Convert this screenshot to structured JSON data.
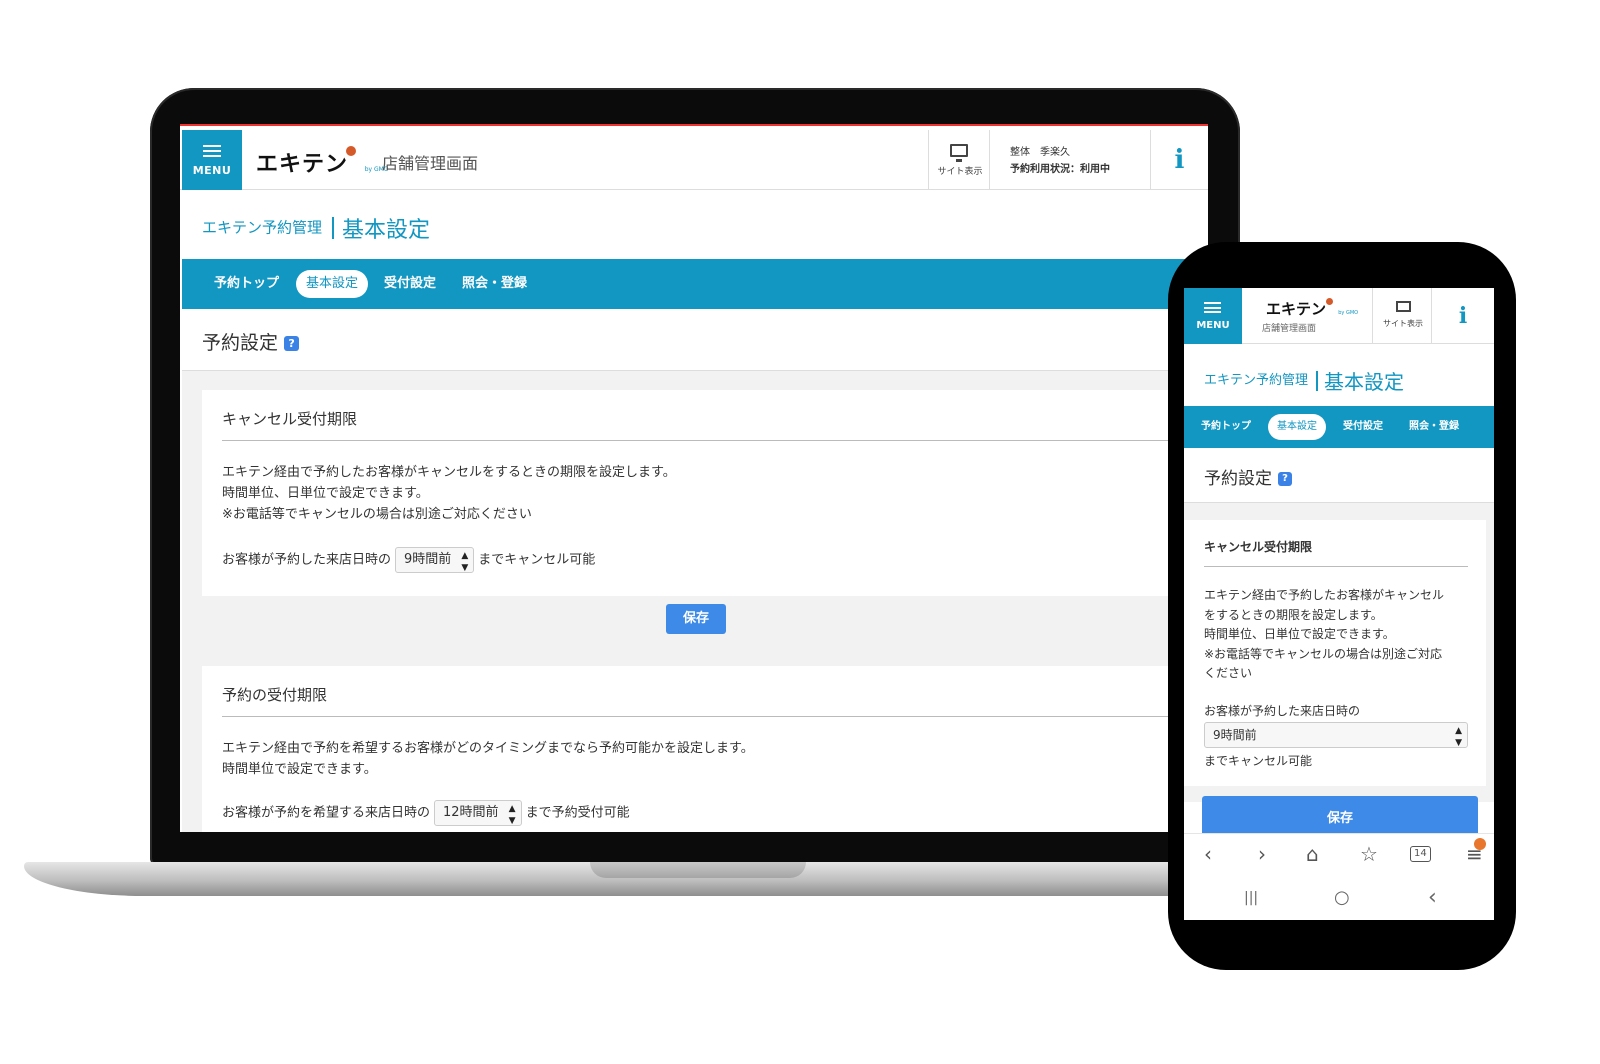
{
  "header": {
    "menu_label": "MENU",
    "logo_text": "エキテン",
    "logo_sub": "by GMO",
    "title": "店舗管理画面",
    "site_label": "サイト表示",
    "shop_name": "整体　季楽久",
    "status": "予約利用状況：利用中",
    "info_label": "i"
  },
  "breadcrumb": {
    "parent": "エキテン予約管理",
    "current": "基本設定"
  },
  "nav": {
    "tabs": [
      {
        "label": "予約トップ"
      },
      {
        "label": "基本設定"
      },
      {
        "label": "受付設定"
      },
      {
        "label": "照会・登録"
      }
    ],
    "active_index": 1
  },
  "section": {
    "title": "予約設定",
    "help": "?"
  },
  "cancel_card": {
    "title": "キャンセル受付期限",
    "desc": [
      "エキテン経由で予約したお客様がキャンセルをするときの期限を設定します。",
      "時間単位、日単位で設定できます。",
      "※お電話等でキャンセルの場合は別途ご対応ください"
    ],
    "prefix": "お客様が予約した来店日時の",
    "select_value": "9時間前",
    "suffix": "までキャンセル可能",
    "save_label": "保存"
  },
  "reserve_card": {
    "title": "予約の受付期限",
    "desc": [
      "エキテン経由で予約を希望するお客様がどのタイミングまでなら予約可能かを設定します。",
      "時間単位で設定できます。"
    ],
    "prefix": "お客様が予約を希望する来店日時の",
    "select_value": "12時間前",
    "suffix": "まで予約受付可能"
  },
  "phone": {
    "logo_sub_title": "店舗管理画面",
    "cancel_desc_lines": [
      "エキテン経由で予約したお客様がキャンセル",
      "をするときの期限を設定します。",
      "時間単位、日単位で設定できます。",
      "※お電話等でキャンセルの場合は別途ご対応",
      "ください"
    ],
    "browser": {
      "back": "‹",
      "forward": "›",
      "home": "⌂",
      "bookmark": "☆",
      "tabs_count": "14",
      "menu": "≡"
    },
    "system": {
      "recents": "|||",
      "home": "○",
      "back": "‹"
    }
  },
  "colors": {
    "brand": "#1296c2",
    "button": "#3d8ae8",
    "logo_ball": "#d55a2a"
  },
  "icons": [
    "menu-icon",
    "monitor-icon",
    "info-icon",
    "help-icon",
    "select-arrow-icon"
  ]
}
